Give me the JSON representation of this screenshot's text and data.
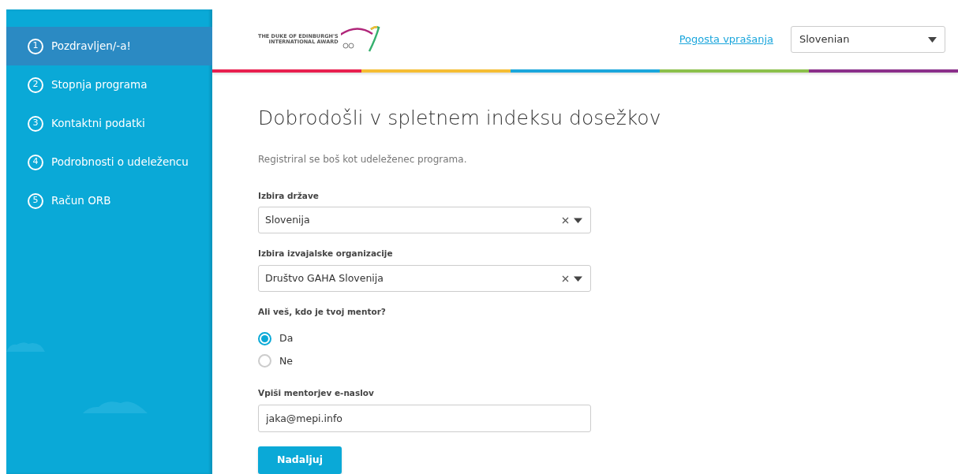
{
  "sidebar": {
    "steps": [
      {
        "number": "1",
        "label": "Pozdravljen/-a!",
        "selected": true
      },
      {
        "number": "2",
        "label": "Stopnja programa",
        "selected": false
      },
      {
        "number": "3",
        "label": "Kontaktni podatki",
        "selected": false
      },
      {
        "number": "4",
        "label": "Podrobnosti o udeležencu",
        "selected": false
      },
      {
        "number": "5",
        "label": "Račun ORB",
        "selected": false
      }
    ]
  },
  "header": {
    "logo": {
      "line_1": "THE DUKE OF EDINBURGH'S",
      "line_2": "INTERNATIONAL AWARD"
    },
    "faq_link": "Pogosta vprašanja",
    "language": "Slovenian"
  },
  "form": {
    "title": "Dobrodošli v spletnem indeksu dosežkov",
    "subtitle": "Registriral se boš kot udeleženec programa.",
    "country": {
      "label": "Izbira države",
      "value": "Slovenija"
    },
    "organization": {
      "label": "Izbira izvajalske organizacije",
      "value": "Društvo GAHA Slovenija"
    },
    "mentor_question": {
      "label": "Ali veš, kdo je tvoj mentor?",
      "options": [
        {
          "label": "Da",
          "selected": true
        },
        {
          "label": "Ne",
          "selected": false
        }
      ]
    },
    "mentor_email": {
      "label": "Vpiši mentorjev e-naslov",
      "value": "jaka@mepi.info"
    },
    "submit": "Nadaljuj"
  }
}
